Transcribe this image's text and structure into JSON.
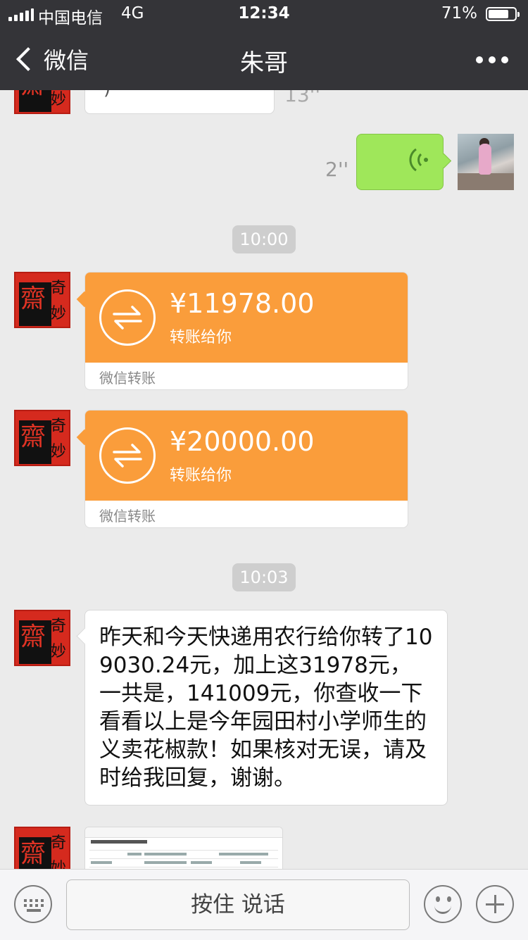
{
  "status_bar": {
    "carrier": "中国电信",
    "network": "4G",
    "time": "12:34",
    "battery_percent": "71%",
    "battery_level": 0.71
  },
  "nav": {
    "back_label": "微信",
    "title": "朱哥"
  },
  "avatar_text": {
    "big": "齋",
    "small_top": "奇",
    "small_bottom": "妙"
  },
  "messages": {
    "voice_top_duration": "13''",
    "voice_self_duration": "2''",
    "time_1": "10:00",
    "transfer_1": {
      "amount": "¥11978.00",
      "subtitle": "转账给你",
      "footer": "微信转账"
    },
    "transfer_2": {
      "amount": "¥20000.00",
      "subtitle": "转账给你",
      "footer": "微信转账"
    },
    "time_2": "10:03",
    "text_1": "昨天和今天快递用农行给你转了109030.24元，加上这31978元，一共是，141009元，你查收一下看看以上是今年园田村小学师生的义卖花椒款！如果核对无误，请及时给我回复，谢谢。"
  },
  "input_bar": {
    "hold_to_talk": "按住 说话"
  },
  "colors": {
    "header_bg": "#343438",
    "chat_bg": "#ebebeb",
    "transfer_orange": "#fa9d3b",
    "self_bubble_green": "#9fe75a"
  },
  "icons": [
    "signal-icon",
    "battery-icon",
    "back-chevron-icon",
    "more-icon",
    "voice-wave-icon",
    "transfer-arrows-icon",
    "keyboard-icon",
    "emoji-icon",
    "plus-icon"
  ]
}
